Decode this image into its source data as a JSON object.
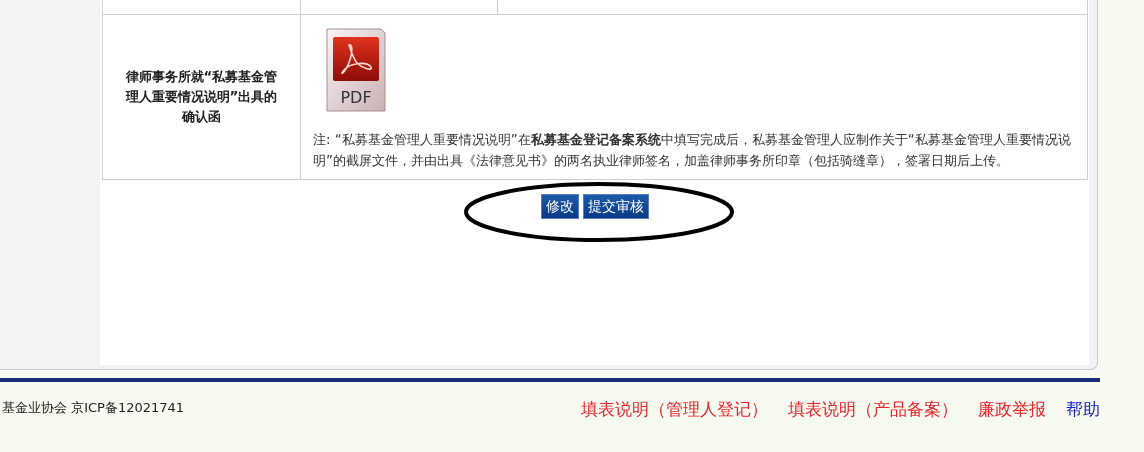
{
  "table": {
    "label": "律师事务所就“私募基金管理人重要情况说明”出具的确认函",
    "attachment": {
      "kind": "pdf",
      "label": "PDF"
    },
    "note": "注: “私募基金管理人重要情况说明”在**私募基金登记备案系统**中填写完成后，私募基金管理人应制作关于“私募基金管理人重要情况说明”的截屏文件，并由出具《法律意见书》的两名执业律师签名，加盖律师事务所印章（包括骑缝章），签署日期后上传。"
  },
  "buttons": [
    {
      "label": "修改"
    },
    {
      "label": "提交审核"
    }
  ],
  "annotation": {
    "kind": "ellipse"
  },
  "footer": {
    "copyright": "基金业协会 京ICP备12021741",
    "links": [
      {
        "label": "填表说明（管理人登记）",
        "color": "#e8232a"
      },
      {
        "label": "填表说明（产品备案）",
        "color": "#e8232a"
      },
      {
        "label": "廉政举报",
        "color": "#e8232a"
      },
      {
        "label": "帮助",
        "color": "#1a22cc"
      }
    ]
  }
}
